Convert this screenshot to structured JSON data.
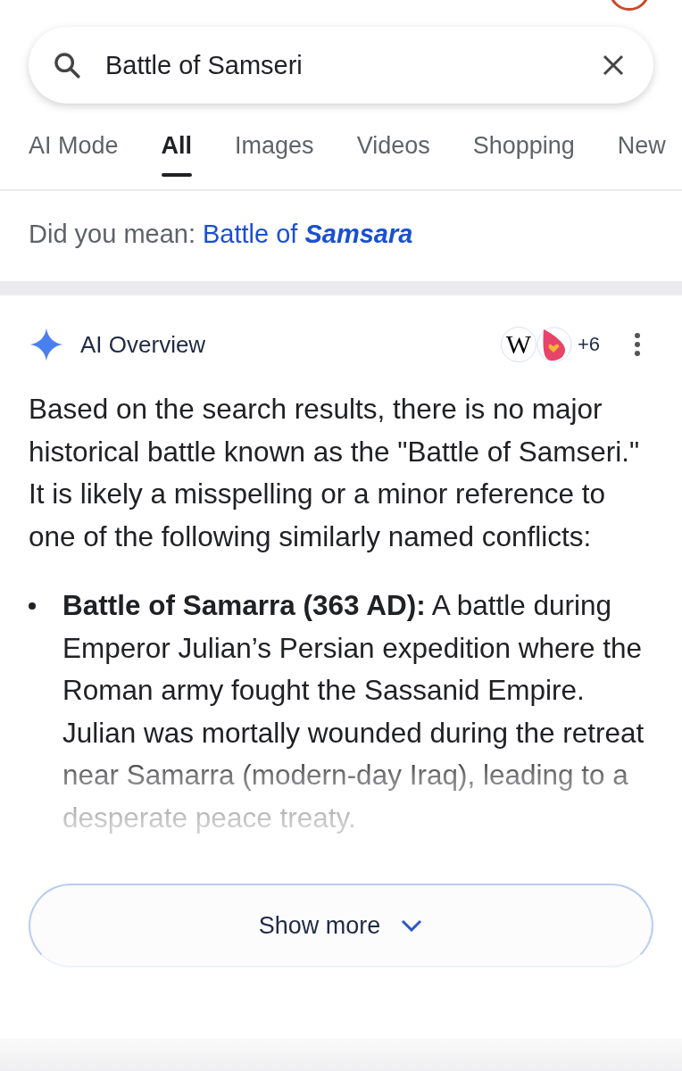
{
  "search": {
    "value": "Battle of Samseri"
  },
  "tabs": [
    {
      "label": "AI Mode",
      "selected": false
    },
    {
      "label": "All",
      "selected": true
    },
    {
      "label": "Images",
      "selected": false
    },
    {
      "label": "Videos",
      "selected": false
    },
    {
      "label": "Shopping",
      "selected": false
    },
    {
      "label": "New",
      "selected": false
    }
  ],
  "did_you_mean": {
    "label": "Did you mean:",
    "link": "Battle of **Samsara**"
  },
  "ai_overview": {
    "title": "AI Overview",
    "source_logo": "W",
    "sources_more": "+6",
    "summary": "Based on the search results, there is no major historical battle known as the \"Battle of Samseri.\" It is likely a misspelling or a minor reference to one of the following similarly named conflicts:",
    "bullets": [
      "**Battle of Samarra (363 AD):** A battle during Emperor Julian’s Persian expedition where the Roman army fought the Sassanid Empire. Julian was mortally wounded during the retreat near Samarra (modern-day Iraq), leading to a desperate peace treaty."
    ],
    "show_more": "Show more"
  }
}
